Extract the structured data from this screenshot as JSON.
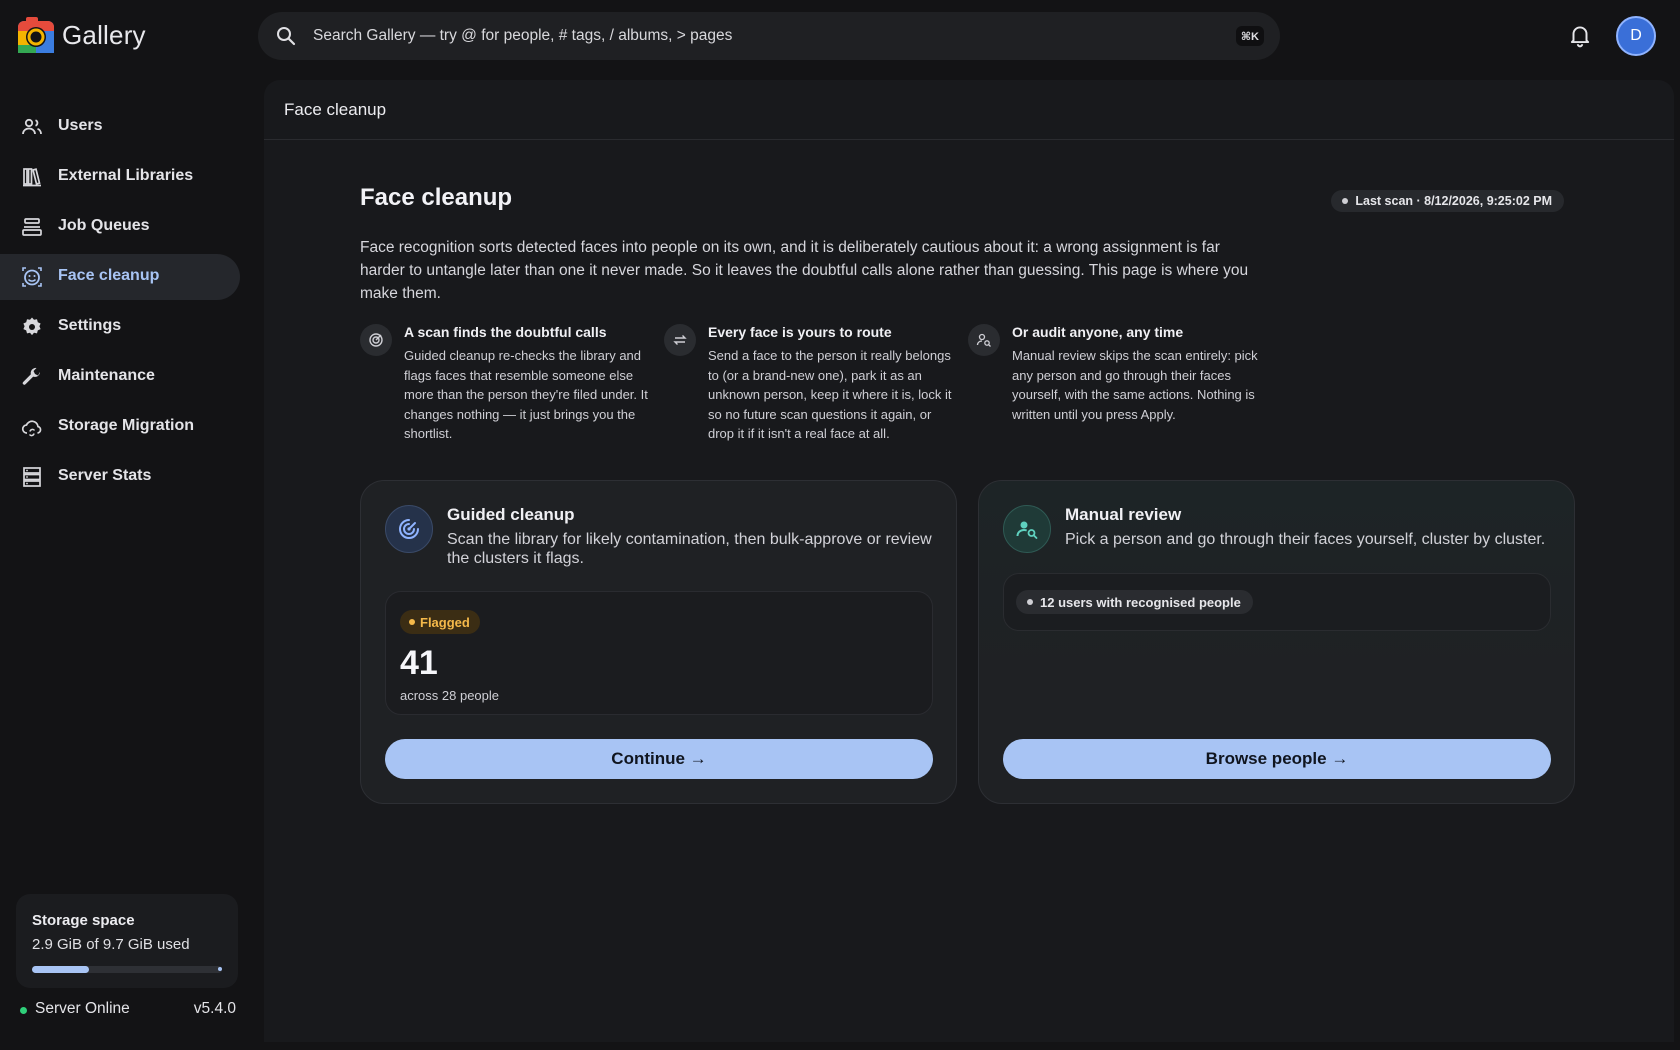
{
  "app": {
    "name": "Gallery"
  },
  "search": {
    "placeholder": "Search Gallery — try @ for people, # tags, / albums, > pages",
    "shortcut": "⌘K"
  },
  "user": {
    "initial": "D"
  },
  "sidebar": {
    "items": [
      {
        "label": "Users",
        "icon": "users-icon",
        "active": false
      },
      {
        "label": "External Libraries",
        "icon": "library-icon",
        "active": false
      },
      {
        "label": "Job Queues",
        "icon": "queue-icon",
        "active": false
      },
      {
        "label": "Face cleanup",
        "icon": "face-icon",
        "active": true
      },
      {
        "label": "Settings",
        "icon": "gear-icon",
        "active": false
      },
      {
        "label": "Maintenance",
        "icon": "wrench-icon",
        "active": false
      },
      {
        "label": "Storage Migration",
        "icon": "cloud-sync-icon",
        "active": false
      },
      {
        "label": "Server Stats",
        "icon": "server-icon",
        "active": false
      }
    ],
    "storage": {
      "title": "Storage space",
      "used_text": "2.9 GiB of 9.7 GiB used",
      "used_fraction": 0.299
    },
    "server": {
      "status": "Server Online",
      "version": "v5.4.0",
      "status_color": "#2fd07a"
    }
  },
  "main": {
    "header_title": "Face cleanup",
    "page_title": "Face cleanup",
    "last_scan": "Last scan · 8/12/2026, 9:25:02 PM",
    "intro": "Face recognition sorts detected faces into people on its own, and it is deliberately cautious about it: a wrong assignment is far harder to untangle later than one it never made. So it leaves the doubtful calls alone rather than guessing. This page is where you make them.",
    "features": [
      {
        "icon": "radar-icon",
        "title": "A scan finds the doubtful calls",
        "desc": "Guided cleanup re-checks the library and flags faces that resemble someone else more than the person they're filed under. It changes nothing — it just brings you the shortlist."
      },
      {
        "icon": "swap-icon",
        "title": "Every face is yours to route",
        "desc": "Send a face to the person it really belongs to (or a brand-new one), park it as an unknown person, keep it where it is, lock it so no future scan questions it again, or drop it if it isn't a real face at all."
      },
      {
        "icon": "person-search-icon",
        "title": "Or audit anyone, any time",
        "desc": "Manual review skips the scan entirely: pick any person and go through their faces yourself, with the same actions. Nothing is written until you press Apply."
      }
    ],
    "guided": {
      "title": "Guided cleanup",
      "subtitle": "Scan the library for likely contamination, then bulk-approve or review the clusters it flags.",
      "badge": "Flagged",
      "count": "41",
      "caption": "across 28 people",
      "button": "Continue →"
    },
    "manual": {
      "title": "Manual review",
      "subtitle": "Pick a person and go through their faces yourself, cluster by cluster.",
      "users_pill": "12 users with recognised people",
      "button": "Browse people →"
    }
  },
  "colors": {
    "accent": "#a8c4f4",
    "flag": "#f5b94a",
    "background": "#131315",
    "panel": "#18191c"
  }
}
